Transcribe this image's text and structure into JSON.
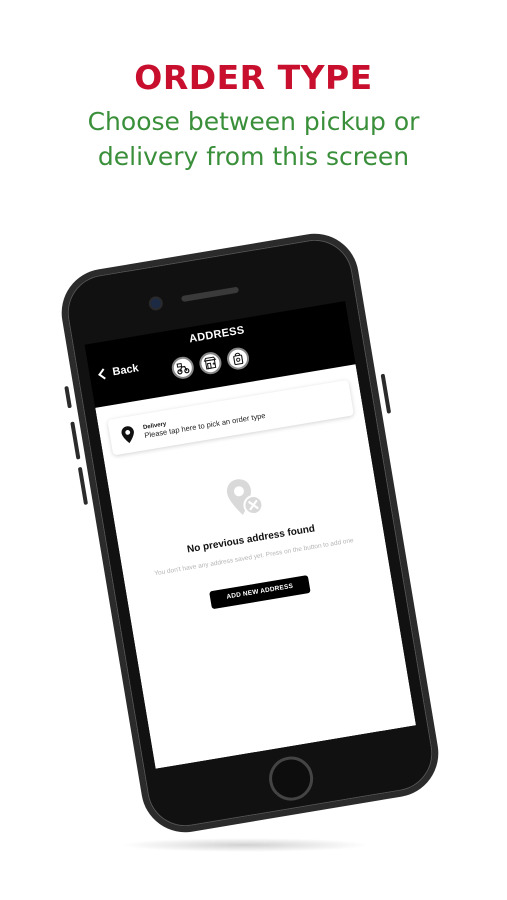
{
  "promo": {
    "title": "ORDER TYPE",
    "subtitle": "Choose between pickup or delivery from this screen"
  },
  "colors": {
    "title": "#c8102e",
    "subtitle": "#3a8f3a",
    "header_bg": "#000000",
    "button_bg": "#000000"
  },
  "app": {
    "header": {
      "back_label": "Back",
      "title": "ADDRESS",
      "order_type_icons": [
        "delivery-scooter-icon",
        "store-pickup-icon",
        "takeaway-bag-icon"
      ]
    },
    "order_type_card": {
      "label": "Delivery",
      "hint": "Please tap here to pick an order type",
      "icon": "location-pin-icon"
    },
    "empty_state": {
      "icon": "location-pin-cross-icon",
      "title": "No previous address found",
      "description": "You don't have any address saved yet. Press on the button to add one",
      "button_label": "ADD NEW ADDRESS"
    }
  }
}
